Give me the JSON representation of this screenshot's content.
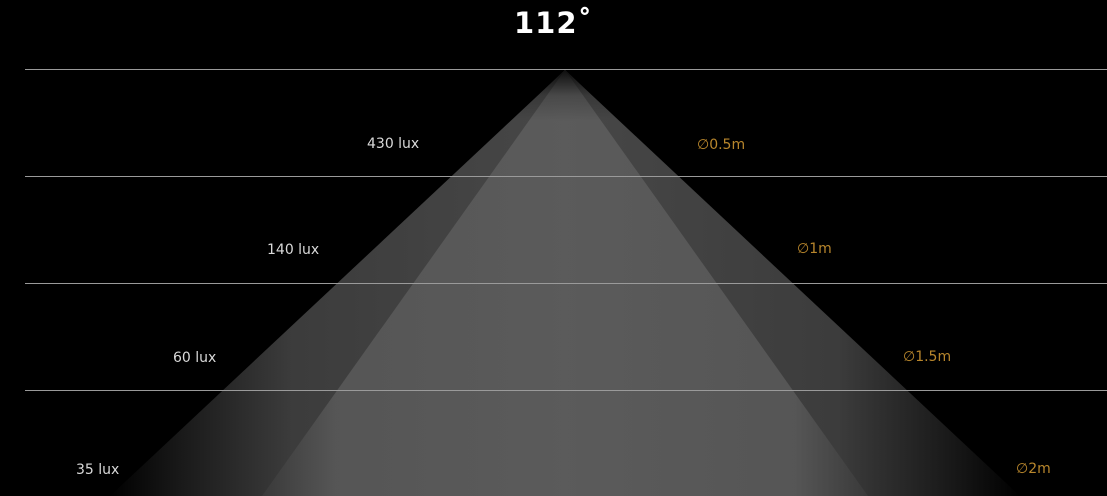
{
  "title": "112˚",
  "levels": [
    {
      "lux": "430 lux",
      "diameter": "∅0.5m"
    },
    {
      "lux": "140 lux",
      "diameter": "∅1m"
    },
    {
      "lux": "60 lux",
      "diameter": "∅1.5m"
    },
    {
      "lux": "35 lux",
      "diameter": "∅2m"
    }
  ],
  "colors": {
    "background": "#000000",
    "guide_line": "#9a9a9a",
    "lux_text": "#d9d9d9",
    "diameter_text": "#b8862c",
    "beam_core": "#5c5c5c",
    "beam_outer": "#2f2f2f"
  }
}
